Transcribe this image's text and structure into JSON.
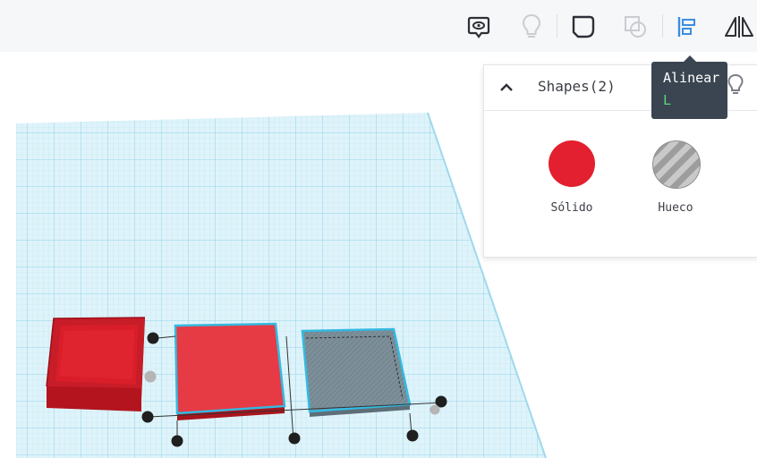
{
  "toolbar": {
    "buttons": [
      {
        "icon": "note-icon",
        "label": ""
      },
      {
        "icon": "lightbulb-icon",
        "label": ""
      },
      {
        "icon": "group-icon",
        "label": ""
      },
      {
        "icon": "ungroup-icon",
        "label": ""
      },
      {
        "icon": "align-icon",
        "label": ""
      },
      {
        "icon": "mirror-icon",
        "label": ""
      }
    ]
  },
  "tooltip": {
    "label": "Alinear",
    "shortcut": "L",
    "shortcut_color": "#56d97b"
  },
  "shape_panel": {
    "title": "Shapes(2)",
    "solid": {
      "label": "Sólido",
      "color": "#e3202f"
    },
    "hole": {
      "label": "Hueco"
    }
  },
  "workplane": {
    "grid_color": "#a9dff0",
    "shapes": [
      {
        "name": "open-box",
        "color": "#e3202f"
      },
      {
        "name": "solid-box",
        "color": "#e3202f"
      },
      {
        "name": "hole-box",
        "color": "#8a9aa4"
      }
    ]
  }
}
